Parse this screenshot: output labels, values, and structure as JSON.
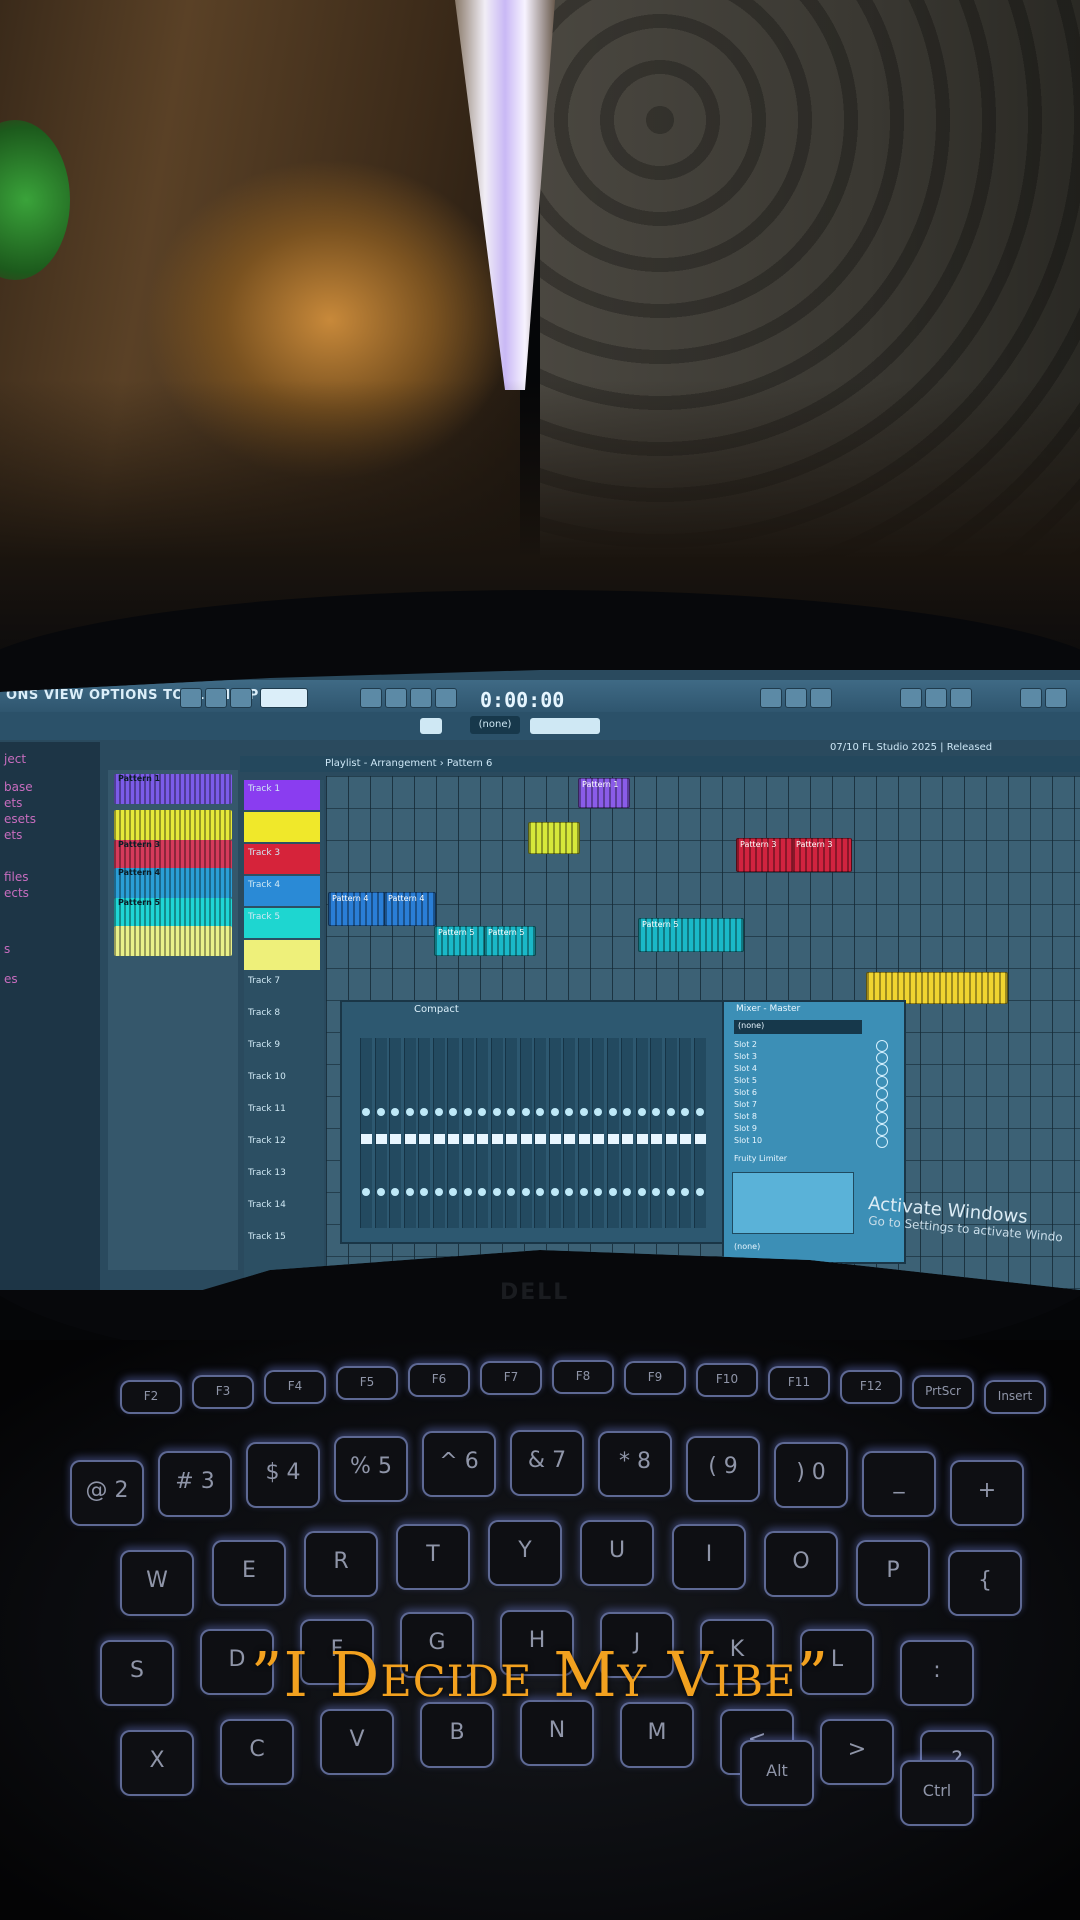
{
  "menu": {
    "text": "ONS VIEW OPTIONS TOOLS HELP"
  },
  "transport": {
    "time": "0:00:00"
  },
  "fl_version": "07/10 FL Studio 2025 | Released",
  "slot_none_label": "(none)",
  "browser": {
    "items": [
      "ject",
      "base",
      "ets",
      "esets",
      "ets",
      "files",
      "ects",
      "s",
      "es"
    ]
  },
  "playlist": {
    "title": "Playlist - Arrangement › Pattern 6"
  },
  "patterns": [
    {
      "label": "Pattern 1",
      "color": "#7b5ce8"
    },
    {
      "label": "",
      "color": "#e6e83a"
    },
    {
      "label": "Pattern 3",
      "color": "#d63a5b"
    },
    {
      "label": "Pattern 4",
      "color": "#2a9ed6"
    },
    {
      "label": "Pattern 5",
      "color": "#1fd6d6"
    },
    {
      "label": "",
      "color": "#e8f08a"
    }
  ],
  "tracks": [
    "Track 1",
    "",
    "Track 3",
    "Track 4",
    "Track 5",
    "",
    "Track 7",
    "Track 8",
    "Track 9",
    "Track 10",
    "Track 11",
    "Track 12",
    "Track 13",
    "Track 14",
    "Track 15"
  ],
  "track_colors": [
    "#8a3df0",
    "#f0e82a",
    "#d6233a",
    "#2a8ad6",
    "#1ed6d0",
    "#eef07a"
  ],
  "clips": [
    {
      "label": "Pattern 1",
      "color": "#8a5ce8"
    },
    {
      "label": "",
      "color": "#d6e83a"
    },
    {
      "label": "Pattern 3",
      "color": "#d0233f"
    },
    {
      "label": "Pattern 3",
      "color": "#d0233f"
    },
    {
      "label": "Pattern 4",
      "color": "#2a7ed6"
    },
    {
      "label": "Pattern 4",
      "color": "#2a7ed6"
    },
    {
      "label": "Pattern 5",
      "color": "#1ab8c8"
    },
    {
      "label": "Pattern 5",
      "color": "#1ab8c8"
    },
    {
      "label": "Pattern 5",
      "color": "#1ab8c8"
    },
    {
      "label": "",
      "color": "#f0d430"
    }
  ],
  "mixer": {
    "title": "Compact",
    "strip_count": 24,
    "master_title": "Mixer - Master",
    "slot_header": "(none)",
    "slots": [
      "Slot 2",
      "Slot 3",
      "Slot 4",
      "Slot 5",
      "Slot 6",
      "Slot 7",
      "Slot 8",
      "Slot 9",
      "Slot 10"
    ],
    "eq_label": "Fruity Limiter",
    "footer": "(none)"
  },
  "windows_notice": {
    "title": "Activate Windows",
    "subtitle": "Go to Settings to activate Windo"
  },
  "monitor_brand": "DELL",
  "keyboard": {
    "fkeys": [
      "F2",
      "F3",
      "F4",
      "F5",
      "F6",
      "F7",
      "F8",
      "F9",
      "F10",
      "F11",
      "F12",
      "PrtScr",
      "Insert"
    ],
    "row_numbers": [
      "@ 2",
      "# 3",
      "$ 4",
      "% 5",
      "^ 6",
      "& 7",
      "* 8",
      "( 9",
      ") 0",
      "_",
      "+"
    ],
    "row_top": [
      "W",
      "E",
      "R",
      "T",
      "Y",
      "U",
      "I",
      "O",
      "P",
      "{"
    ],
    "row_mid": [
      "S",
      "D",
      "F",
      "G",
      "H",
      "J",
      "K",
      "L",
      ":"
    ],
    "row_bottom": [
      "X",
      "C",
      "V",
      "B",
      "N",
      "M",
      "<",
      ">",
      "?"
    ],
    "mods": [
      "Alt",
      "Ctrl"
    ]
  },
  "quote": "”I Decide My Vibe”"
}
